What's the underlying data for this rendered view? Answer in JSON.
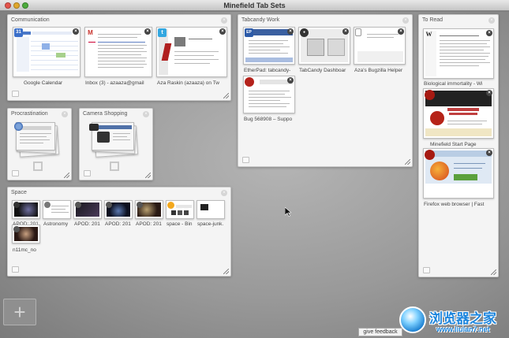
{
  "window": {
    "title": "Minefield Tab Sets"
  },
  "groups": {
    "communication": {
      "title": "Communication",
      "tabs": [
        {
          "label": "Google Calendar",
          "icon": "calendar-icon"
        },
        {
          "label": "Inbox (3) - azaaza@gmail",
          "icon": "gmail-icon",
          "favicon_text": "M"
        },
        {
          "label": "Aza Raskin (azaaza) on Tw",
          "icon": "twitter-icon"
        }
      ]
    },
    "tabcandy": {
      "title": "Tabcandy Work",
      "tabs": [
        {
          "label": "EtherPad: tabcandy-",
          "icon": "etherpad-icon",
          "favicon_text": "EP"
        },
        {
          "label": "TabCandy Dashboar",
          "icon": "tabcandy-icon"
        },
        {
          "label": "Aza's Bugzilla Helper",
          "icon": "document-icon"
        },
        {
          "label": "Bug 568908 – Suppo",
          "icon": "bugzilla-icon"
        }
      ]
    },
    "toread": {
      "title": "To Read",
      "tabs": [
        {
          "label": "Biological immortality - Wi",
          "icon": "wikipedia-icon",
          "favicon_text": "W"
        },
        {
          "label": "Minefield Start Page",
          "icon": "minefield-icon"
        },
        {
          "label": "Firefox web browser | Fast",
          "icon": "firefox-icon"
        }
      ]
    },
    "procrastination": {
      "title": "Procrastination"
    },
    "camera": {
      "title": "Camera Shopping"
    },
    "space": {
      "title": "Space",
      "tabs": [
        {
          "label": "APOD: 201"
        },
        {
          "label": "Astronomy"
        },
        {
          "label": "APOD: 201"
        },
        {
          "label": "APOD: 201"
        },
        {
          "label": "APOD: 201"
        },
        {
          "label": "space - Bin"
        },
        {
          "label": "space-junk."
        },
        {
          "label": "n11mc_no"
        }
      ]
    }
  },
  "feedback": {
    "label": "give feedback"
  },
  "watermark": {
    "main": "浏览器之家",
    "url": "www.liulan7.net"
  },
  "colors": {
    "canvas": "#9c9c9c",
    "group_bg": "#f4f4f4",
    "accent": "#1e86dd"
  }
}
